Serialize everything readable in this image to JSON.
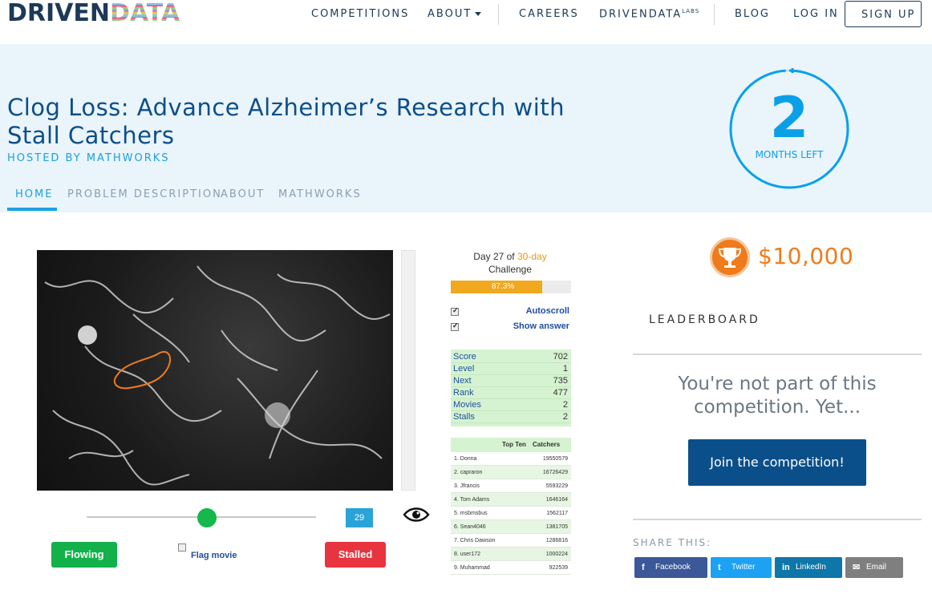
{
  "brand": {
    "logo_part1": "DRIVEN",
    "logo_part2": "DATA"
  },
  "nav": {
    "items": [
      {
        "label": "COMPETITIONS"
      },
      {
        "label": "ABOUT"
      },
      {
        "label": "CAREERS"
      },
      {
        "label": "DRIVENDATA"
      },
      {
        "label": "BLOG"
      },
      {
        "label": "LOG IN"
      }
    ],
    "labs_sup": "LABS",
    "signup": "SIGN UP"
  },
  "hero": {
    "title": "Clog Loss: Advance Alzheimer’s Research with Stall Catchers",
    "host": "HOSTED BY MATHWORKS",
    "tabs": [
      {
        "label": "HOME"
      },
      {
        "label": "PROBLEM DESCRIPTION"
      },
      {
        "label": "ABOUT"
      },
      {
        "label": "MATHWORKS"
      }
    ],
    "countdown": {
      "number": "2",
      "label": "MONTHS LEFT",
      "remaining_fraction": 0.99
    }
  },
  "game": {
    "day_prefix": "Day 27 of",
    "day_highlight": "30-day",
    "day_suffix": "Challenge",
    "progress_label": "87.3%",
    "progress_value": 0.873,
    "autoscroll": "Autoscroll",
    "show_answer": "Show answer",
    "stats": [
      {
        "k": "Score",
        "v": "702"
      },
      {
        "k": "Level",
        "v": "1"
      },
      {
        "k": "Next",
        "v": "735"
      },
      {
        "k": "Rank",
        "v": "477"
      },
      {
        "k": "Movies",
        "v": "2"
      },
      {
        "k": "Stalls",
        "v": "2"
      }
    ],
    "topten_header_1": "Top Ten",
    "topten_header_2": "Catchers",
    "topten": [
      {
        "n": "1. Donna",
        "s": "19550579"
      },
      {
        "n": "2. capraron",
        "s": "16726429"
      },
      {
        "n": "3. Jfrancis",
        "s": "5593229"
      },
      {
        "n": "4. Tom Adams",
        "s": "1646164"
      },
      {
        "n": "5. msbmsbus",
        "s": "1562117"
      },
      {
        "n": "6. Sean4046",
        "s": "1381705"
      },
      {
        "n": "7. Chris Dawson",
        "s": "1286816"
      },
      {
        "n": "8. user172",
        "s": "1000224"
      },
      {
        "n": "9. Muhammad",
        "s": "922539"
      }
    ],
    "frame_number": "29",
    "flowing": "Flowing",
    "stalled": "Stalled",
    "flag_movie": "Flag movie"
  },
  "sidebar": {
    "prize": "$10,000",
    "leaderboard": "LEADERBOARD",
    "not_part": "You're not part of this competition. Yet...",
    "join": "Join the competition!",
    "share_label": "SHARE THIS:",
    "share": [
      {
        "icon": "f",
        "label": "Facebook"
      },
      {
        "icon": "t",
        "label": "Twitter"
      },
      {
        "icon": "in",
        "label": "LinkedIn"
      },
      {
        "icon": "✉",
        "label": "Email"
      }
    ]
  },
  "colors": {
    "navy": "#1c3a57",
    "blue": "#0b4f8a",
    "accent": "#1ba1e2",
    "orange": "#f07b1a",
    "hero_bg": "#eaf4fb"
  }
}
